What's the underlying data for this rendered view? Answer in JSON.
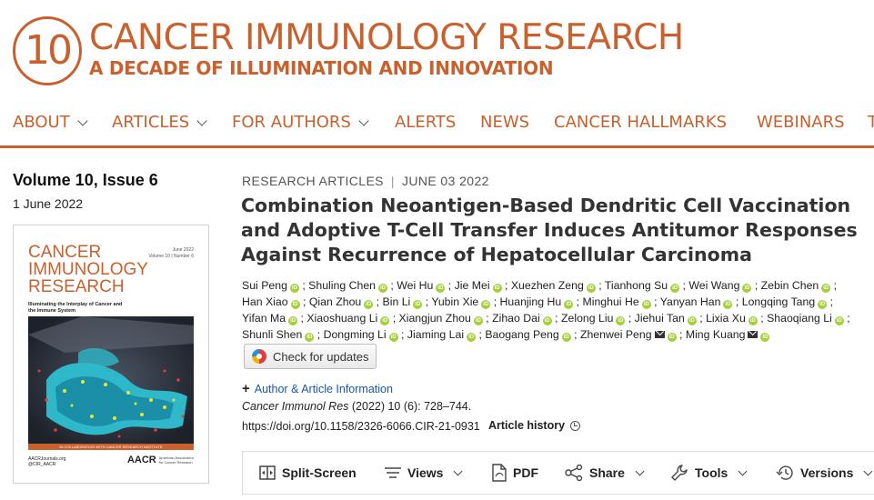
{
  "brand": {
    "logo_number": "10",
    "title": "CANCER IMMUNOLOGY RESEARCH",
    "subtitle": "A DECADE OF ILLUMINATION AND INNOVATION",
    "color": "#c8612e"
  },
  "nav": {
    "items": [
      {
        "label": "ABOUT",
        "has_dropdown": true
      },
      {
        "label": "ARTICLES",
        "has_dropdown": true
      },
      {
        "label": "FOR AUTHORS",
        "has_dropdown": true
      },
      {
        "label": "ALERTS",
        "has_dropdown": false
      },
      {
        "label": "NEWS",
        "has_dropdown": false
      },
      {
        "label": "CANCER HALLMARKS",
        "has_dropdown": false
      },
      {
        "label": "WEBINARS",
        "has_dropdown": false
      },
      {
        "label": "T",
        "has_dropdown": false
      }
    ]
  },
  "issue": {
    "title": "Volume 10, Issue 6",
    "date": "1 June 2022",
    "cover": {
      "title": "CANCER IMMUNOLOGY RESEARCH",
      "meta_date": "June 2022",
      "meta_volume": "Volume 10 | Number 6",
      "tagline": "Illuminating the Interplay of Cancer and the Immune System",
      "band": "IN COLLABORATION WITH CANCER RESEARCH INSTITUTE",
      "footer_left_1": "AACRJournals.org",
      "footer_left_2": "@CIR_AACR",
      "aacr": "AACR",
      "aacr_sub_1": "American Association",
      "aacr_sub_2": "for Cancer Research"
    }
  },
  "article": {
    "category": "RESEARCH ARTICLES",
    "date": "JUNE 03 2022",
    "title": "Combination Neoantigen-Based Dendritic Cell Vaccination and Adoptive T-Cell Transfer Induces Antitumor Responses Against Recurrence of Hepatocellular Carcinoma",
    "authors": [
      {
        "name": "Sui Peng",
        "orcid": true,
        "mail": false
      },
      {
        "name": "Shuling Chen",
        "orcid": true,
        "mail": false
      },
      {
        "name": "Wei Hu",
        "orcid": true,
        "mail": false
      },
      {
        "name": "Jie Mei",
        "orcid": true,
        "mail": false
      },
      {
        "name": "Xuezhen Zeng",
        "orcid": true,
        "mail": false
      },
      {
        "name": "Tianhong Su",
        "orcid": true,
        "mail": false
      },
      {
        "name": "Wei Wang",
        "orcid": true,
        "mail": false
      },
      {
        "name": "Zebin Chen",
        "orcid": true,
        "mail": false
      },
      {
        "name": "Han Xiao",
        "orcid": true,
        "mail": false
      },
      {
        "name": "Qian Zhou",
        "orcid": true,
        "mail": false
      },
      {
        "name": "Bin Li",
        "orcid": true,
        "mail": false
      },
      {
        "name": "Yubin Xie",
        "orcid": true,
        "mail": false
      },
      {
        "name": "Huanjing Hu",
        "orcid": true,
        "mail": false
      },
      {
        "name": "Minghui He",
        "orcid": true,
        "mail": false
      },
      {
        "name": "Yanyan Han",
        "orcid": true,
        "mail": false
      },
      {
        "name": "Longqing Tang",
        "orcid": true,
        "mail": false
      },
      {
        "name": "Yifan Ma",
        "orcid": true,
        "mail": false
      },
      {
        "name": "Xiaoshuang Li",
        "orcid": true,
        "mail": false
      },
      {
        "name": "Xiangjun Zhou",
        "orcid": true,
        "mail": false
      },
      {
        "name": "Zihao Dai",
        "orcid": true,
        "mail": false
      },
      {
        "name": "Zelong Liu",
        "orcid": true,
        "mail": false
      },
      {
        "name": "Jiehui Tan",
        "orcid": true,
        "mail": false
      },
      {
        "name": "Lixia Xu",
        "orcid": true,
        "mail": false
      },
      {
        "name": "Shaoqiang Li",
        "orcid": true,
        "mail": false
      },
      {
        "name": "Shunli Shen",
        "orcid": true,
        "mail": false
      },
      {
        "name": "Dongming Li",
        "orcid": true,
        "mail": false
      },
      {
        "name": "Jiaming Lai",
        "orcid": true,
        "mail": false
      },
      {
        "name": "Baogang Peng",
        "orcid": true,
        "mail": false
      },
      {
        "name": "Zhenwei Peng",
        "orcid": true,
        "mail": true
      },
      {
        "name": "Ming Kuang",
        "orcid": true,
        "mail": true
      }
    ],
    "check_updates_label": "Check for updates",
    "author_info_label": "Author & Article Information",
    "citation_journal": "Cancer Immunol Res",
    "citation_rest": " (2022) 10 (6): 728–744.",
    "doi": "https://doi.org/10.1158/2326-6066.CIR-21-0931",
    "history_label": "Article history"
  },
  "toolbar": {
    "split_screen": "Split-Screen",
    "views": "Views",
    "pdf": "PDF",
    "share": "Share",
    "tools": "Tools",
    "versions": "Versions"
  },
  "colors": {
    "accent": "#c8612e",
    "link": "#1a56a6",
    "orcid": "#a6ce39"
  }
}
